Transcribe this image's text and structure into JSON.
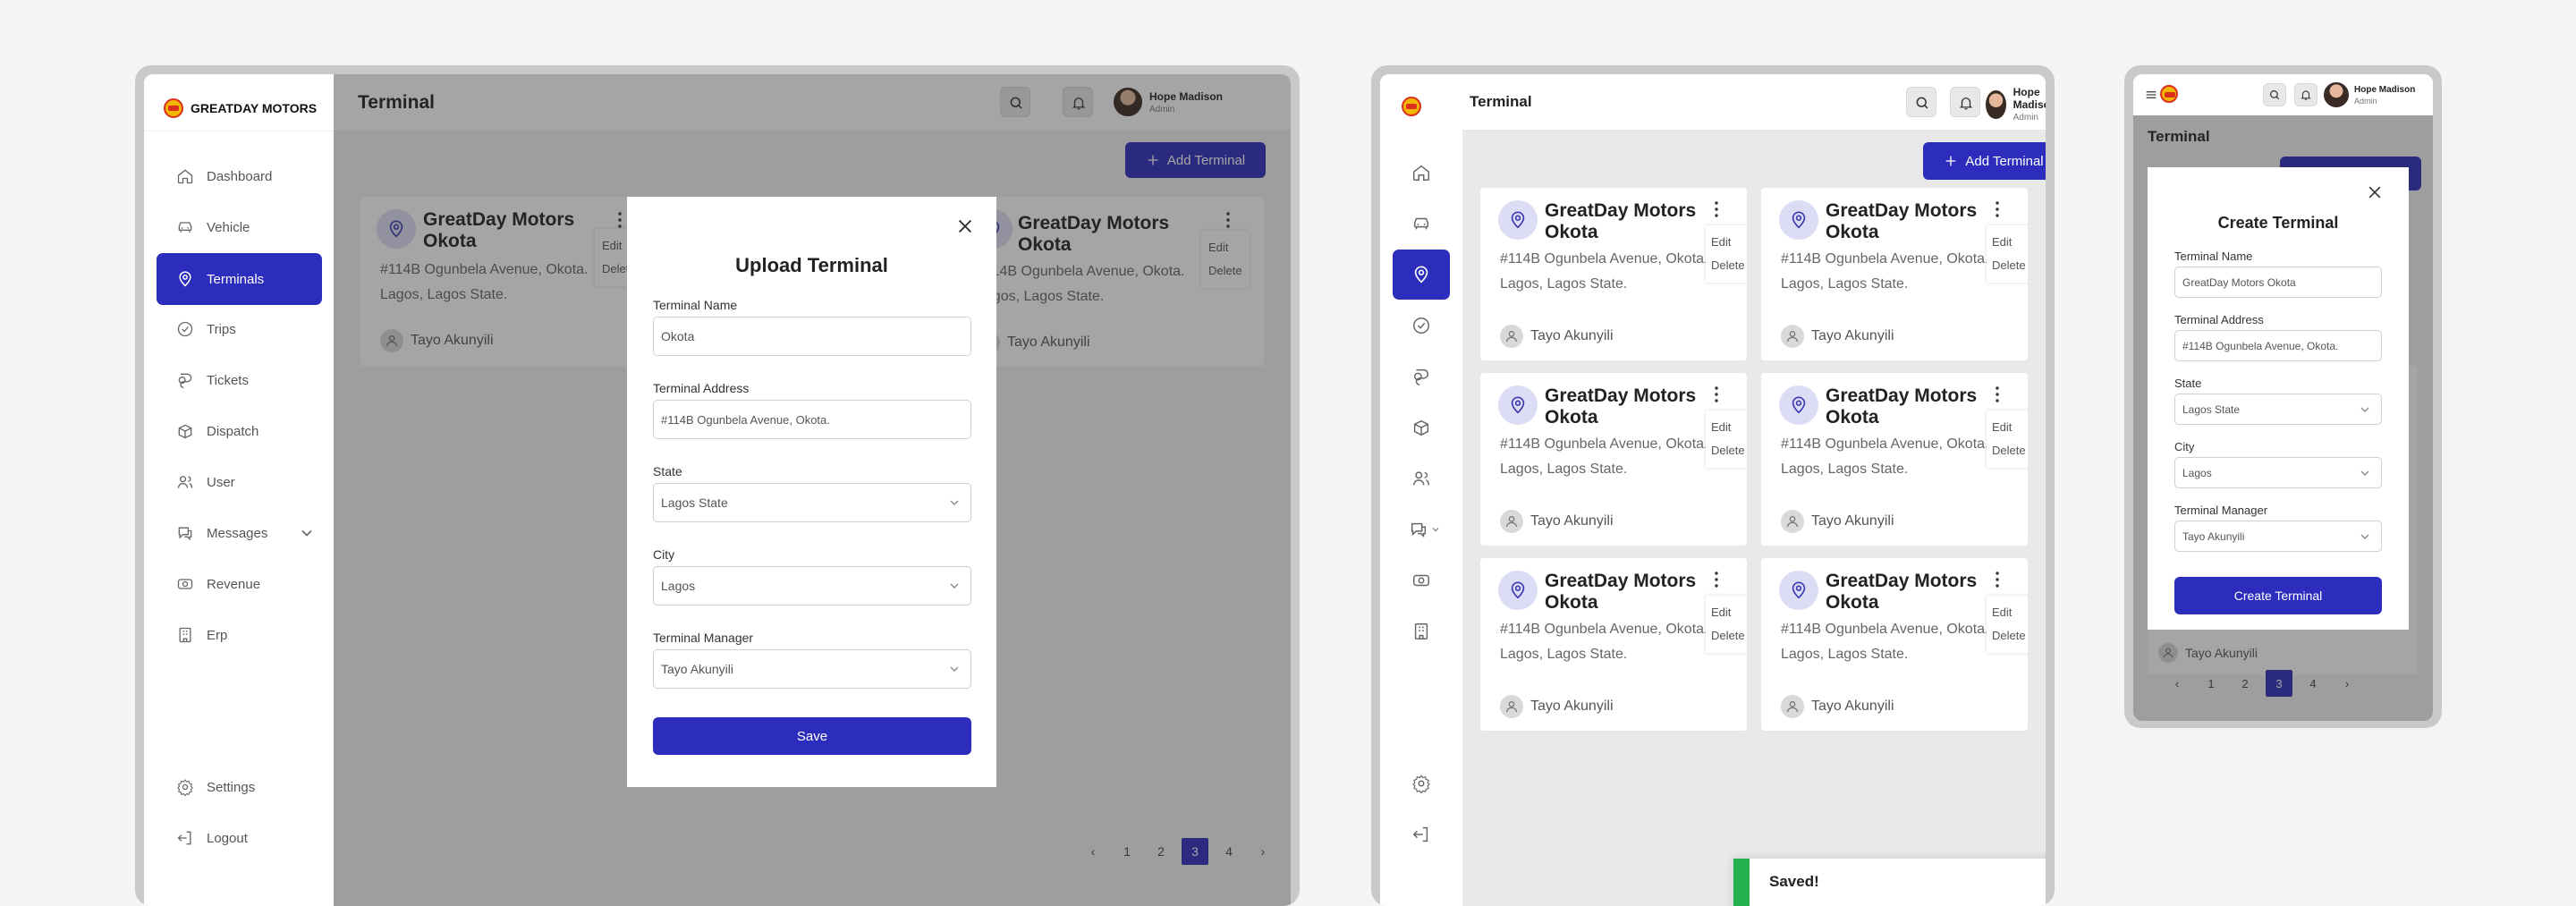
{
  "brand": {
    "name": "GREATDAY MOTORS"
  },
  "header": {
    "title": "Terminal",
    "user_name": "Hope Madison",
    "user_role": "Admin"
  },
  "sidebar": {
    "items": [
      {
        "label": "Dashboard",
        "icon": "home-icon"
      },
      {
        "label": "Vehicle",
        "icon": "car-icon"
      },
      {
        "label": "Terminals",
        "icon": "location-pin-icon",
        "active": true
      },
      {
        "label": "Trips",
        "icon": "check-circle-icon"
      },
      {
        "label": "Tickets",
        "icon": "ticket-icon"
      },
      {
        "label": "Dispatch",
        "icon": "package-icon"
      },
      {
        "label": "User",
        "icon": "users-icon"
      },
      {
        "label": "Messages",
        "icon": "chat-icon"
      },
      {
        "label": "Revenue",
        "icon": "money-icon"
      },
      {
        "label": "Erp",
        "icon": "building-icon"
      }
    ],
    "settings_label": "Settings",
    "logout_label": "Logout"
  },
  "add_button_label": "Add Terminal",
  "card": {
    "title": "GreatDay Motors Okota",
    "address_line1": "#114B Ogunbela Avenue, Okota.",
    "address_line2": "Lagos, Lagos State.",
    "manager": "Tayo Akunyili",
    "menu_edit": "Edit",
    "menu_delete": "Delete"
  },
  "pagination": {
    "pages": [
      "1",
      "2",
      "3",
      "4"
    ],
    "current": "3",
    "prev": "‹",
    "next": "›"
  },
  "upload_modal": {
    "title": "Upload Terminal",
    "name_label": "Terminal Name",
    "name_value": "Okota",
    "address_label": "Terminal Address",
    "address_value": "#114B Ogunbela Avenue, Okota.",
    "state_label": "State",
    "state_value": "Lagos State",
    "city_label": "City",
    "city_value": "Lagos",
    "manager_label": "Terminal Manager",
    "manager_value": "Tayo Akunyili",
    "save_label": "Save"
  },
  "create_modal": {
    "title": "Create Terminal",
    "name_label": "Terminal Name",
    "name_value": "GreatDay Motors Okota",
    "address_label": "Terminal Address",
    "address_value": "#114B Ogunbela Avenue, Okota.",
    "state_label": "State",
    "state_value": "Lagos State",
    "city_label": "City",
    "city_value": "Lagos",
    "manager_label": "Terminal Manager",
    "manager_value": "Tayo Akunyili",
    "submit_label": "Create Terminal"
  },
  "toast": {
    "message": "Saved!"
  },
  "colors": {
    "primary": "#2C2CBD",
    "success": "#22B14C",
    "pin_bg": "#DCDCF5"
  }
}
